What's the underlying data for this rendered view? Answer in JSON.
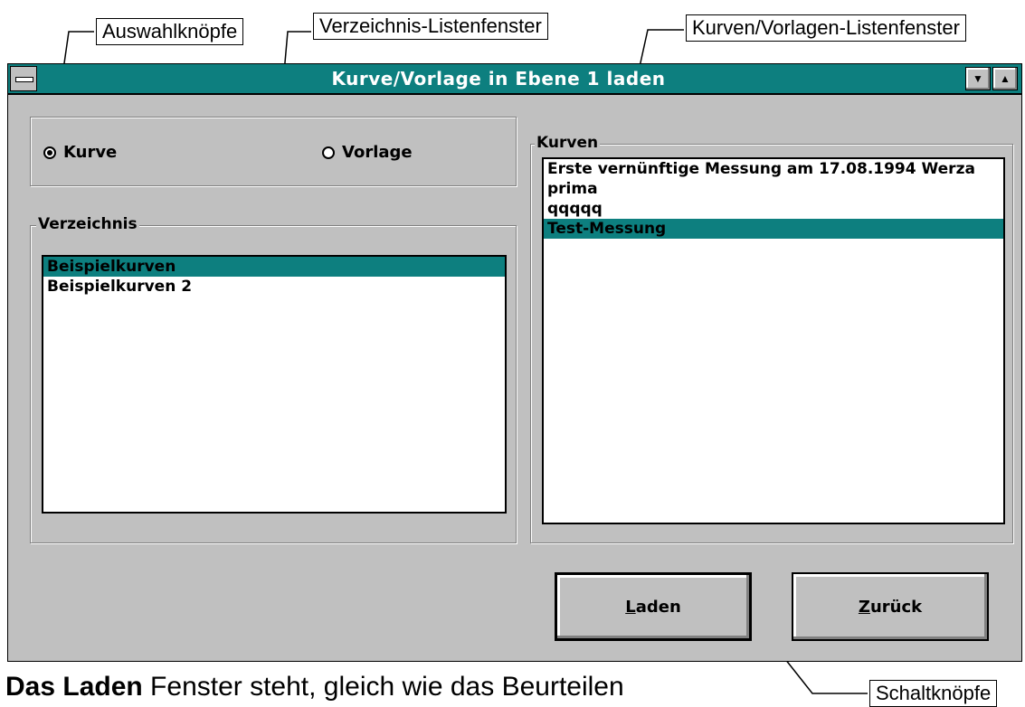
{
  "callouts": {
    "radio": "Auswahlknöpfe",
    "dirlist": "Verzeichnis-Listenfenster",
    "curvelist": "Kurven/Vorlagen-Listenfenster",
    "buttons": "Schaltknöpfe"
  },
  "dialog": {
    "title": "Kurve/Vorlage in Ebene 1 laden",
    "minimize_glyph": "▼",
    "maximize_glyph": "▲"
  },
  "selection": {
    "options": [
      {
        "label": "Kurve",
        "checked": true
      },
      {
        "label": "Vorlage",
        "checked": false
      }
    ]
  },
  "directory": {
    "label": "Verzeichnis",
    "items": [
      {
        "label": "Beispielkurven",
        "selected": true
      },
      {
        "label": "Beispielkurven 2",
        "selected": false
      }
    ]
  },
  "curves": {
    "label": "Kurven",
    "items": [
      {
        "label": "Erste vernünftige Messung am 17.08.1994 Werza",
        "selected": false
      },
      {
        "label": "prima",
        "selected": false
      },
      {
        "label": "qqqqq",
        "selected": false
      },
      {
        "label": "Test-Messung",
        "selected": true
      }
    ]
  },
  "buttons": {
    "load_mnemonic": "L",
    "load_rest": "aden",
    "back_mnemonic": "Z",
    "back_rest": "urück"
  },
  "caption": {
    "bold": "Das Laden",
    "rest": " Fenster steht, gleich wie das Beurteilen"
  },
  "colors": {
    "accent": "#0d7f7f",
    "face": "#c0c0c0"
  }
}
